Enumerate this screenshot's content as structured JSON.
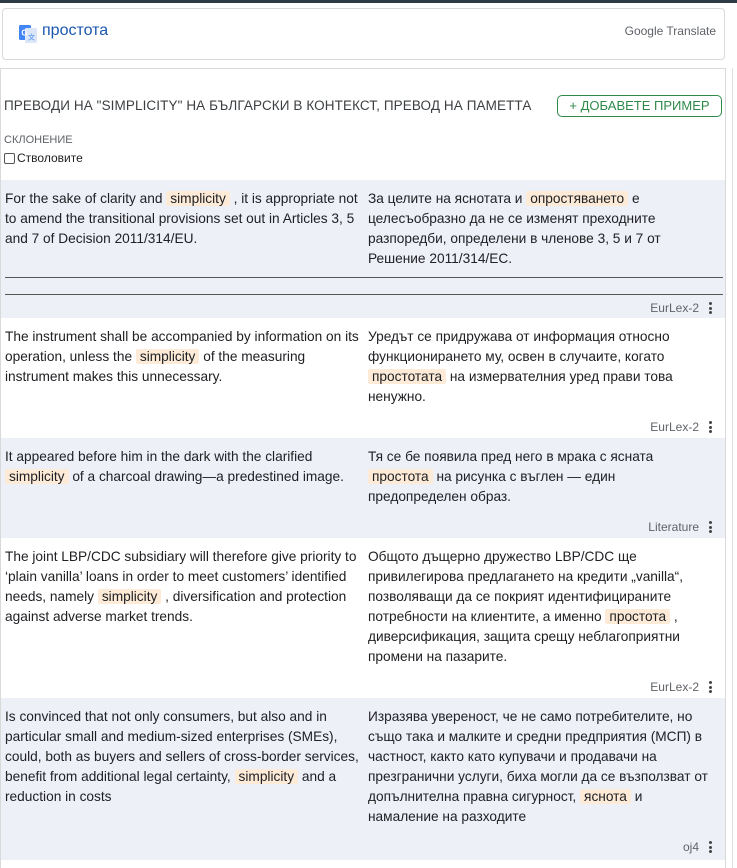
{
  "header": {
    "word": "простота",
    "google_translate": "Google Translate"
  },
  "section": {
    "heading": "ПРЕВОДИ НА \"SIMPLICITY\" НА БЪЛГАРСКИ В КОНТЕКСТ, ПРЕВОД НА ПАМЕТТА",
    "add_button": "+ ДОБАВЕТЕ ПРИМЕР",
    "declension_label": "СКЛОНЕНИЕ",
    "stems_label": "Стволовите"
  },
  "examples": [
    {
      "src_pre": "For the sake of clarity and ",
      "src_hl": "simplicity",
      "src_post": " , it is appropriate not to amend the transitional provisions set out in Articles 3, 5 and 7 of Decision 2011/314/EU.",
      "tgt_pre": "За целите на яснотата и ",
      "tgt_hl": "опростяването",
      "tgt_post": " е целесъобразно да не се изменят преходните разпоредби, определени в членове 3, 5 и 7 от Решение 2011/314/ЕС.",
      "source": "EurLex-2"
    },
    {
      "src_pre": "The instrument shall be accompanied by information on its operation, unless the ",
      "src_hl": "simplicity",
      "src_post": " of the measuring instrument makes this unnecessary.",
      "tgt_pre": "Уредът се придружава от информация относно функционирането му, освен в случаите, когато ",
      "tgt_hl": "простотата",
      "tgt_post": " на измервателния уред прави това ненужно.",
      "source": "EurLex-2"
    },
    {
      "src_pre": "It appeared before him in the dark with the clarified ",
      "src_hl": "simplicity",
      "src_post": " of a charcoal drawing—a predestined image.",
      "tgt_pre": "Тя се бе появила пред него в мрака с ясната ",
      "tgt_hl": "простота",
      "tgt_post": " на рисунка с въглен — един предопределен образ.",
      "source": "Literature"
    },
    {
      "src_pre": "The joint LBP/CDC subsidiary will therefore give priority to ‘plain vanilla’ loans in order to meet customers’ identified needs, namely ",
      "src_hl": "simplicity",
      "src_post": " , diversification and protection against adverse market trends.",
      "tgt_pre": "Общото дъщерно дружество LBP/CDC ще привилегирова предлагането на кредити „vanilla“, позволяващи да се покрият идентифицираните потребности на клиентите, а именно ",
      "tgt_hl": "простота",
      "tgt_post": " , диверсификация, защита срещу неблагоприятни промени на пазарите.",
      "source": "EurLex-2"
    },
    {
      "src_pre": "Is convinced that not only consumers, but also and in particular small and medium-sized enterprises (SMEs), could, both as buyers and sellers of cross-border services, benefit from additional legal certainty, ",
      "src_hl": "simplicity",
      "src_post": " and a reduction in costs",
      "tgt_pre": "Изразява увереност, че не само потребителите, но също така и малките и средни предприятия (МСП) в частност, както като купувачи и продавачи на презгранични услуги, биха могли да се възползват от допълнителна правна сигурност, ",
      "tgt_hl": "яснота",
      "tgt_post": " и намаление на разходите",
      "source": "oj4"
    }
  ]
}
